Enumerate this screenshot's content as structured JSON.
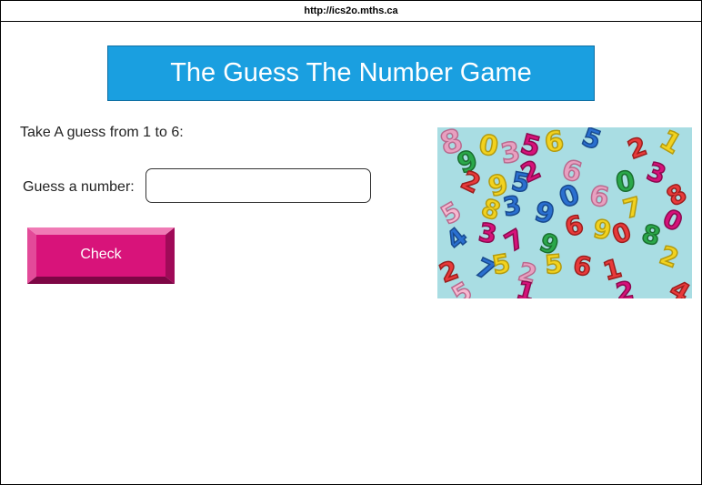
{
  "browser": {
    "url": "http://ics2o.mths.ca"
  },
  "page": {
    "title": "The Guess The Number Game",
    "instruction": "Take A guess from 1 to 6:",
    "guess_label": "Guess a number:",
    "guess_input_value": "",
    "check_button_label": "Check"
  },
  "image": {
    "icon": "colorful-numbers-image"
  },
  "colors": {
    "title_background": "#1a9fe0",
    "button_primary": "#d8137a",
    "image_background": "#a9dde3"
  }
}
